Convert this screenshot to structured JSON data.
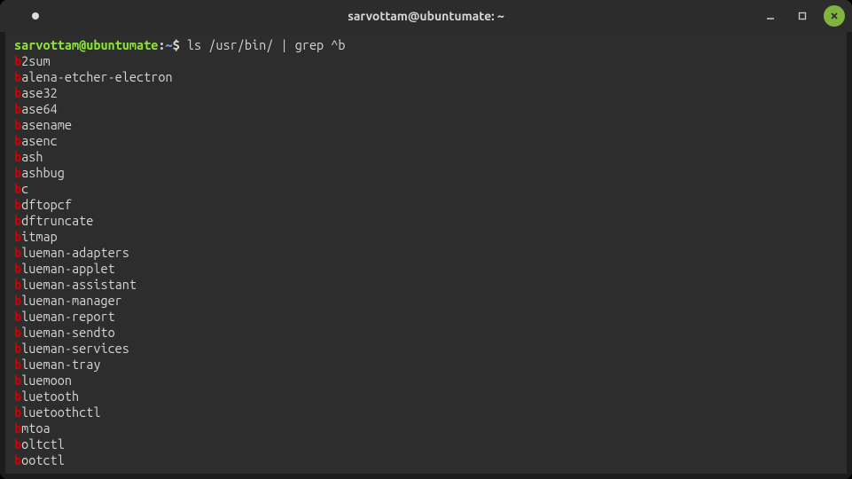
{
  "window": {
    "title": "sarvottam@ubuntumate: ~"
  },
  "prompt": {
    "user_host": "sarvottam@ubuntumate",
    "colon": ":",
    "path": "~",
    "symbol": "$"
  },
  "command": " ls /usr/bin/ | grep ^b",
  "grep_highlight": "b",
  "output": [
    "2sum",
    "alena-etcher-electron",
    "ase32",
    "ase64",
    "asename",
    "asenc",
    "ash",
    "ashbug",
    "c",
    "dftopcf",
    "dftruncate",
    "itmap",
    "lueman-adapters",
    "lueman-applet",
    "lueman-assistant",
    "lueman-manager",
    "lueman-report",
    "lueman-sendto",
    "lueman-services",
    "lueman-tray",
    "luemoon",
    "luetooth",
    "luetoothctl",
    "mtoa",
    "oltctl",
    "ootctl"
  ]
}
